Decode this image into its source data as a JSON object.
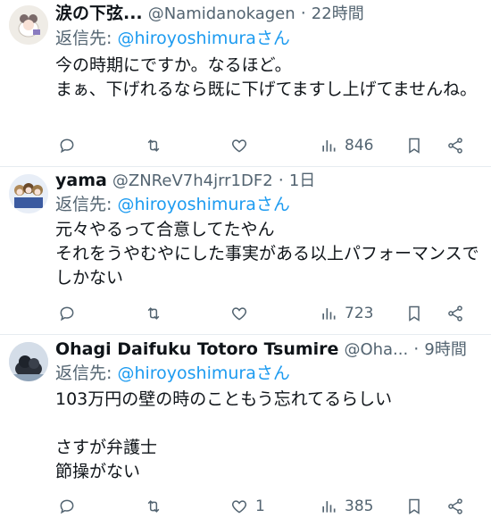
{
  "tweets": [
    {
      "name": "涙の下弦...",
      "handle": "@Namidanokagen",
      "time": "22時間",
      "reply_prefix": "返信先:",
      "reply_to": "@hiroyoshimuraさん",
      "text": "今の時期にですか。なるほど。\nまぁ、下げれるなら既に下げてますし上げてませんね。",
      "views": "846",
      "likes": ""
    },
    {
      "name": "yama",
      "handle": "@ZNReV7h4jrr1DF2",
      "time": "1日",
      "reply_prefix": "返信先:",
      "reply_to": "@hiroyoshimuraさん",
      "text": "元々やるって合意してたやん\nそれをうやむやにした事実がある以上パフォーマンスでしかない",
      "views": "723",
      "likes": ""
    },
    {
      "name": "Ohagi Daifuku Totoro Tsumire",
      "handle": "@Oha...",
      "time": "9時間",
      "reply_prefix": "返信先:",
      "reply_to": "@hiroyoshimuraさん",
      "text": "103万円の壁の時のこともう忘れてるらしい\n\nさすが弁護士\n節操がない",
      "views": "385",
      "likes": "1"
    }
  ],
  "icons": {
    "reply": "reply-icon",
    "retweet": "retweet-icon",
    "like": "heart-icon",
    "views": "views-icon",
    "bookmark": "bookmark-icon",
    "share": "share-icon",
    "more": "more-icon"
  },
  "colors": {
    "text": "#0f1419",
    "secondary": "#536471",
    "link": "#1d9bf0",
    "divider": "#e6ecf0"
  }
}
